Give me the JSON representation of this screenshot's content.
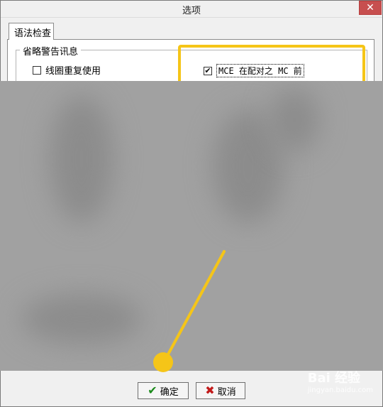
{
  "window": {
    "title": "选项"
  },
  "tabs": [
    {
      "label": "语法检查"
    }
  ],
  "group": {
    "title": "省略警告讯息",
    "options": [
      {
        "label": "线圈重复使用",
        "checked": false
      },
      {
        "label": "MCE 在配对之 MC 前",
        "checked": true
      }
    ]
  },
  "buttons": {
    "ok": "确定",
    "cancel": "取消"
  },
  "watermark": {
    "brand": "Bai 经验",
    "url": "jingyan.baidu.com"
  },
  "colors": {
    "highlight": "#f5c518",
    "ok_icon": "#1a8a1a",
    "cancel_icon": "#c21a1a",
    "close_button": "#c74f4f"
  },
  "icons": {
    "ok": "checkmark-icon",
    "cancel": "x-mark-icon",
    "close": "close-icon"
  }
}
